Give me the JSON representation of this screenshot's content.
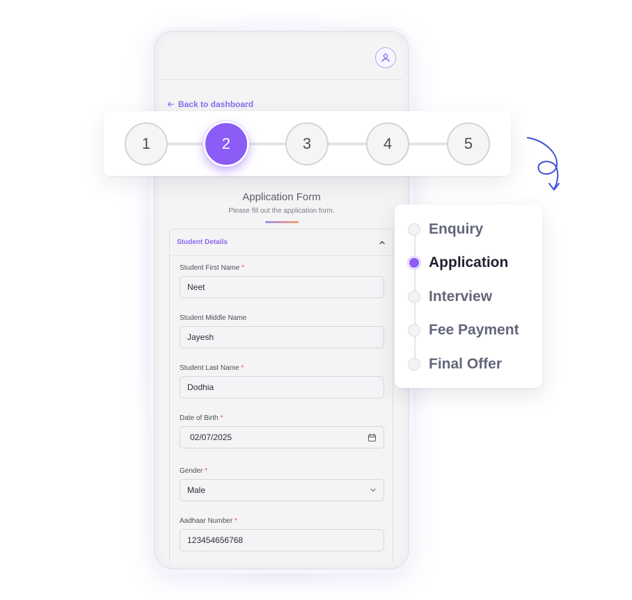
{
  "header": {
    "back_label": "Back to dashboard"
  },
  "form": {
    "title": "Application Form",
    "subtitle": "Please fill out the application form.",
    "section_title": "Student Details",
    "fields": [
      {
        "label": "Student First Name",
        "required": true,
        "value": "Neet"
      },
      {
        "label": "Student Middle Name",
        "required": false,
        "value": "Jayesh"
      },
      {
        "label": "Student Last Name",
        "required": true,
        "value": "Dodhia"
      },
      {
        "label": "Date of Birth",
        "required": true,
        "value": "02/07/2025"
      },
      {
        "label": "Gender",
        "required": true,
        "value": "Male"
      },
      {
        "label": "Aadhaar Number",
        "required": true,
        "value": "123454656768"
      }
    ],
    "required_mark": "*"
  },
  "stepper": {
    "steps": [
      "1",
      "2",
      "3",
      "4",
      "5"
    ],
    "active_index": 1
  },
  "stages": {
    "items": [
      "Enquiry",
      "Application",
      "Interview",
      "Fee Payment",
      "Final Offer"
    ],
    "active_index": 1
  },
  "colors": {
    "accent": "#8b5cf6",
    "link": "#8b6af0",
    "required": "#e05252",
    "squiggle": "#3b4fd6"
  },
  "icons": [
    "user-icon",
    "arrow-left-icon",
    "chevron-up-icon",
    "calendar-icon",
    "chevron-down-icon"
  ]
}
